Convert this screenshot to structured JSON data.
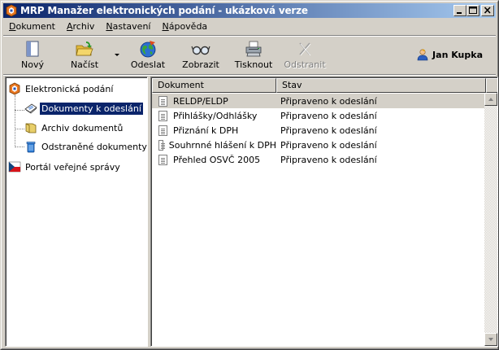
{
  "window": {
    "title": "MRP Manažer elektronických podání - ukázková verze",
    "controls": {
      "minimize": "_",
      "maximize": "□",
      "close": "×"
    }
  },
  "menu": {
    "items": [
      {
        "first": "D",
        "rest": "okument"
      },
      {
        "first": "A",
        "rest": "rchiv"
      },
      {
        "first": "N",
        "rest": "astavení"
      },
      {
        "first": "N",
        "rest": "ápověda"
      }
    ]
  },
  "toolbar": {
    "new": "Nový",
    "open": "Načíst",
    "send": "Odeslat",
    "view": "Zobrazit",
    "print": "Tisknout",
    "remove": "Odstranit",
    "remove_disabled": true
  },
  "user": {
    "name": "Jan Kupka"
  },
  "tree": {
    "root": "Elektronická podání",
    "children": [
      {
        "label": "Dokumenty k odeslání",
        "selected": true
      },
      {
        "label": "Archiv dokumentů"
      },
      {
        "label": "Odstraněné dokumenty"
      }
    ],
    "portal": "Portál veřejné správy"
  },
  "list": {
    "columns": [
      "Dokument",
      "Stav"
    ],
    "rows": [
      {
        "name": "RELDP/ELDP",
        "status": "Připraveno k odeslání"
      },
      {
        "name": "Přihlášky/Odhlášky",
        "status": "Připraveno k odeslání"
      },
      {
        "name": "Přiznání k DPH",
        "status": "Připraveno k odeslání"
      },
      {
        "name": "Souhrnné hlášení k DPH",
        "status": "Připraveno k odeslání"
      },
      {
        "name": "Přehled OSVČ 2005",
        "status": "Připraveno k odeslání"
      }
    ]
  },
  "colors": {
    "titlebar_start": "#0a246a",
    "titlebar_end": "#a6caf0",
    "selection": "#0a246a",
    "face": "#d4d0c8"
  }
}
